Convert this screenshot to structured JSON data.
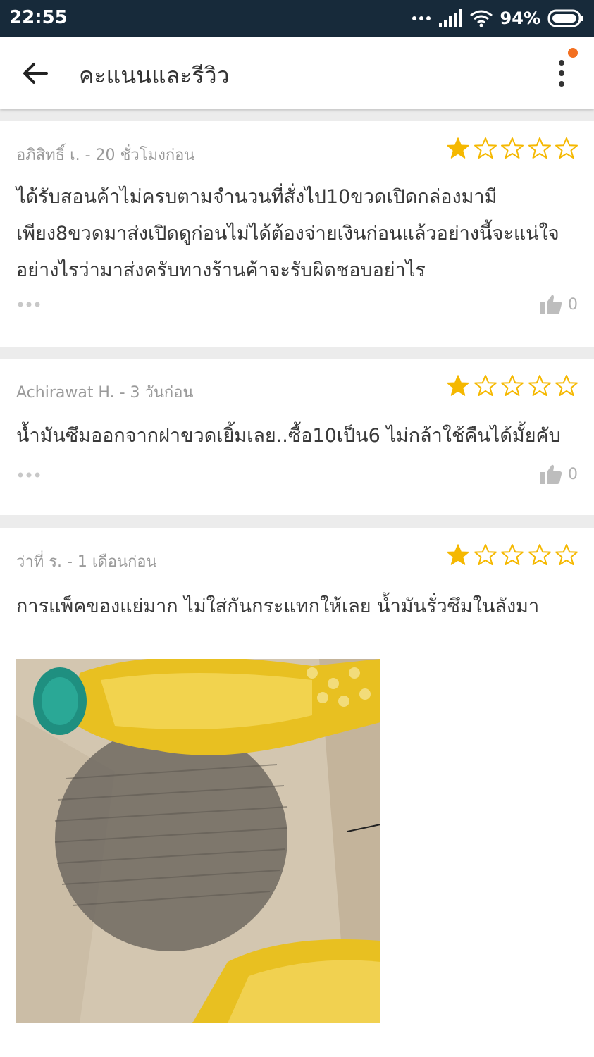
{
  "status_bar": {
    "time": "22:55",
    "battery": "94%"
  },
  "header": {
    "title": "คะแนนและรีวิว",
    "notification_color": "#f37021"
  },
  "reviews": [
    {
      "meta": "อภิสิทธิ์ เ. - 20 ชั่วโมงก่อน",
      "rating": 1,
      "max_rating": 5,
      "text": "ได้รับสอนค้าไม่ครบตามจำนวนที่สั่งไป10ขวดเปิดกล่องมามีเพียง8ขวดมาส่งเปิดดูก่อนไม่ได้ต้องจ่ายเงินก่อนแล้วอย่างนี้จะแน่ใจอย่างไรว่ามาส่งครับทางร้านค้าจะรับผิดชอบอย่าไร",
      "likes": "0"
    },
    {
      "meta": "Achirawat H. - 3 วันก่อน",
      "rating": 1,
      "max_rating": 5,
      "text": "น้ำมันซึมออกจากฝาขวดเยิ้มเลย..ซื้อ10เป็น6  ไม่กล้าใช้คืนได้มั้ยคับ",
      "likes": "0"
    },
    {
      "meta": "ว่าที่ ร. - 1  เดือนก่อน",
      "rating": 1,
      "max_rating": 5,
      "text": "การแพ็คของแย่มาก ไม่ใส่กันกระแทกให้เลย น้ำมันรั่วซึมในลังมา",
      "has_photo": true
    }
  ],
  "colors": {
    "star_filled": "#f5b800",
    "star_outline": "#f5b800",
    "status_bar_bg": "#172a3a"
  }
}
